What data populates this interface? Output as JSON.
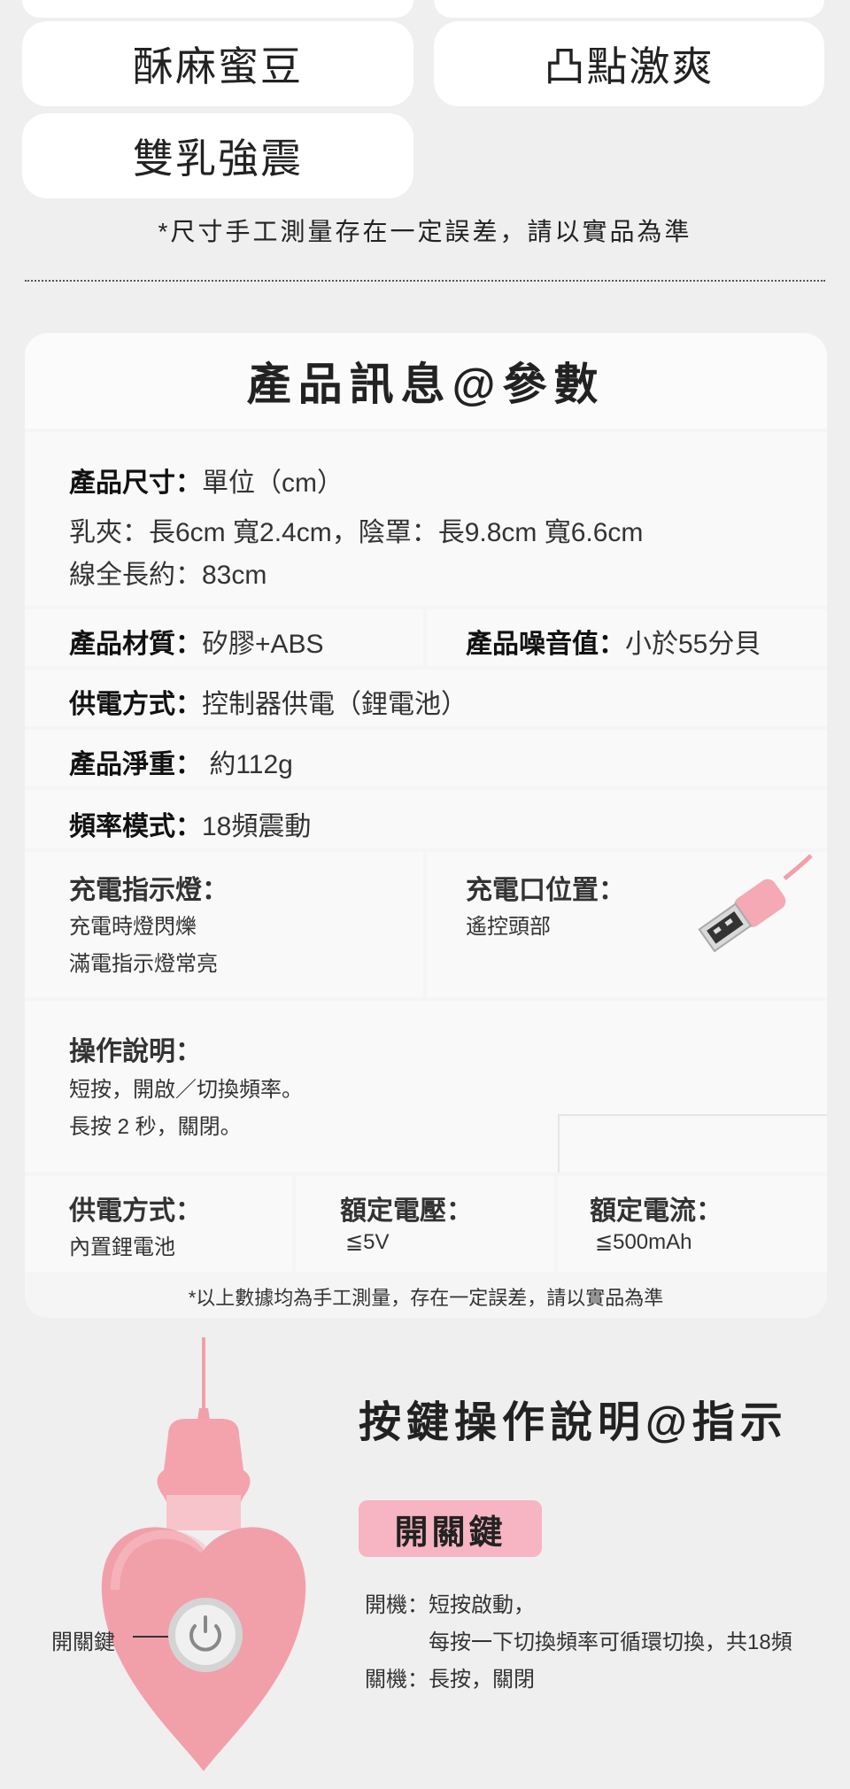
{
  "modes": {
    "row3_left": "酥麻蜜豆",
    "row3_right": "凸點激爽",
    "row4_left": "雙乳強震"
  },
  "size_note": "*尺寸手工測量存在一定誤差，請以實品為準",
  "spec": {
    "title": "產品訊息@參數",
    "size_label": "產品尺寸：",
    "size_unit": "單位（cm）",
    "size_line1": "乳夾：長6cm 寬2.4cm，陰罩：長9.8cm 寬6.6cm",
    "size_line2": "線全長約：83cm",
    "material_label": "產品材質：",
    "material_value": "矽膠+ABS",
    "noise_label": "產品噪音值：",
    "noise_value": "小於55分貝",
    "power_label": "供電方式：",
    "power_value": "控制器供電（鋰電池）",
    "weight_label": "產品淨重：",
    "weight_value": "約112g",
    "freq_label": "頻率模式：",
    "freq_value": "18頻震動",
    "charge_light_label": "充電指示燈：",
    "charge_light_line1": "充電時燈閃爍",
    "charge_light_line2": "滿電指示燈常亮",
    "charge_port_label": "充電口位置：",
    "charge_port_value": "遙控頭部",
    "operation_label": "操作說明：",
    "operation_line1": "短按，開啟／切換頻率。",
    "operation_line2": "長按 2 秒，關閉。",
    "supply_label": "供電方式：",
    "supply_value": "內置鋰電池",
    "voltage_label": "額定電壓：",
    "voltage_value": "≦5V",
    "current_label": "額定電流：",
    "current_value": "≦500mAh",
    "footnote": "*以上數據均為手工測量，存在一定誤差，請以實品為準"
  },
  "buttons": {
    "title": "按鍵操作說明@指示",
    "tag": "開關鍵",
    "on_label": "開機：",
    "on_line1": "短按啟動，",
    "on_line2": "每按一下切換頻率可循環切換，共18頻",
    "off_label": "關機：",
    "off_value": "長按，關閉",
    "callout": "開關鍵"
  },
  "colors": {
    "pink": "#f7b4c2",
    "remote_pink": "#f1a0aa",
    "background": "#efefef"
  }
}
